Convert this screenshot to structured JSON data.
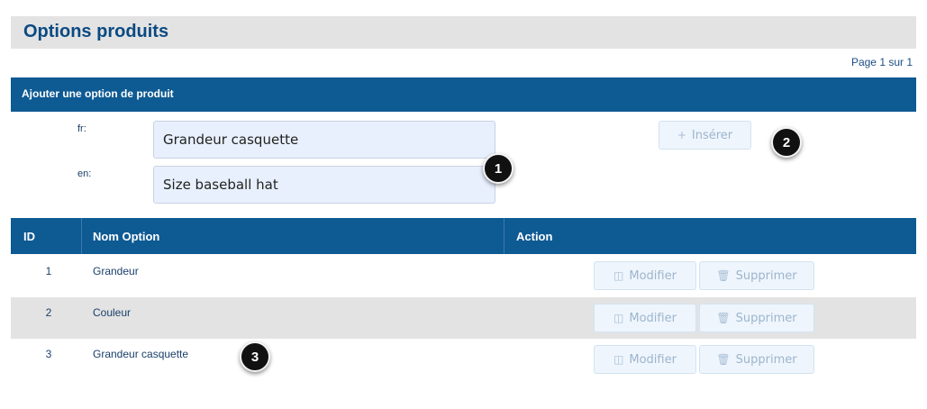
{
  "header": {
    "title": "Options produits"
  },
  "pagination": {
    "text": "Page 1 sur 1"
  },
  "add_section": {
    "title": "Ajouter une option de produit",
    "fields": [
      {
        "lang_label": "fr:",
        "value": "Grandeur casquette"
      },
      {
        "lang_label": "en:",
        "value": "Size baseball hat"
      }
    ],
    "insert_button": {
      "icon": "plus-icon",
      "label": "Insérer"
    }
  },
  "table": {
    "columns": [
      "ID",
      "Nom Option",
      "Action"
    ],
    "rows": [
      {
        "id": "1",
        "name": "Grandeur"
      },
      {
        "id": "2",
        "name": "Couleur"
      },
      {
        "id": "3",
        "name": "Grandeur casquette"
      }
    ],
    "edit_label": "Modifier",
    "delete_label": "Supprimer"
  },
  "markers": [
    "1",
    "2",
    "3"
  ],
  "colors": {
    "header_bar": "#0e5a93",
    "title_bar": "#e3e3e3",
    "button_bg": "#eef5fc",
    "input_bg": "#e8f0fe",
    "marker_bg": "#111111"
  }
}
